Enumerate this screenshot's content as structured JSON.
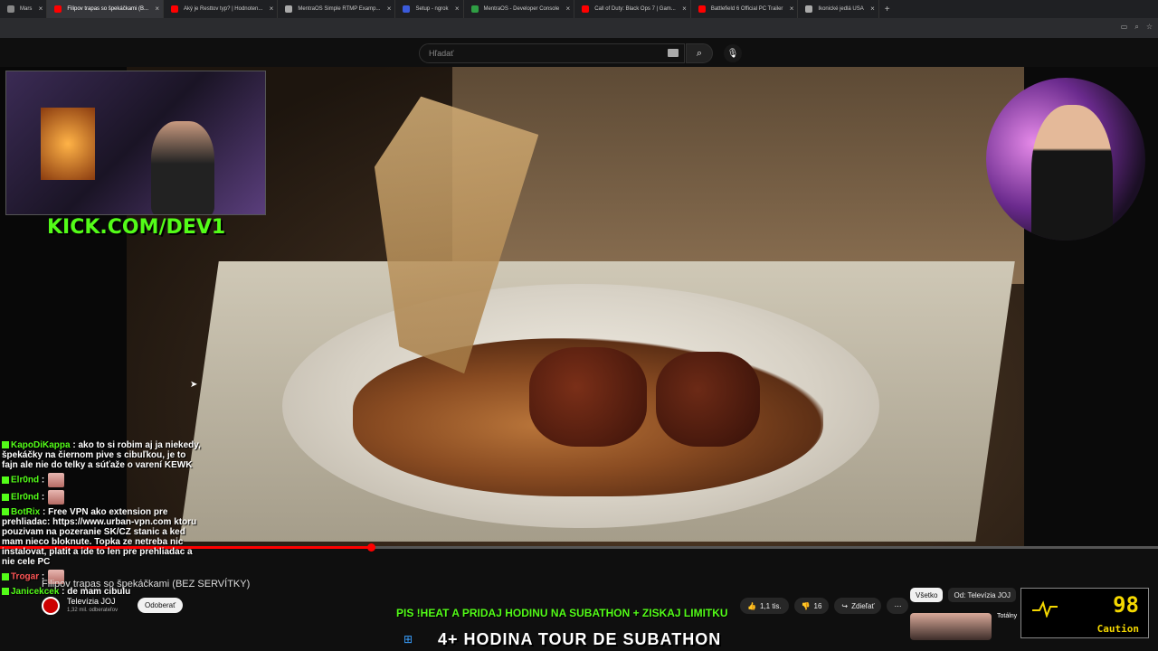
{
  "tabs": [
    {
      "label": "Mars",
      "color": "#888888",
      "active": false
    },
    {
      "label": "Filipov trapas so špekáčkami (B...",
      "color": "#ff0000",
      "active": true
    },
    {
      "label": "Aký je Resttov typ? | Hodnoten...",
      "color": "#ff0000",
      "active": false
    },
    {
      "label": "MentraOS Simple RTMP Examp...",
      "color": "#aaaaaa",
      "active": false
    },
    {
      "label": "Setup - ngrok",
      "color": "#3b5bdb",
      "active": false
    },
    {
      "label": "MentraOS - Developer Console",
      "color": "#2f9e44",
      "active": false
    },
    {
      "label": "Call of Duty: Black Ops 7 | Gam...",
      "color": "#ff0000",
      "active": false
    },
    {
      "label": "Battlefield 6 Official PC Trailer",
      "color": "#ff0000",
      "active": false
    },
    {
      "label": "Ikonické jedlá USA",
      "color": "#aaaaaa",
      "active": false
    }
  ],
  "newtab": "+",
  "search": {
    "placeholder": "Hľadať"
  },
  "overlay": {
    "kick": "KICK.COM/DEV1",
    "ticker": "PIS !HEAT A PRIDAJ HODINU NA SUBATHON + ZISKAJ LIMITKU",
    "banner": "4+ HODINA TOUR DE SUBATHON"
  },
  "chat": [
    {
      "user": "KapoDiKappa",
      "text": ": ako to si robim aj ja niekedy, špekáčky na čiernom pive s cibuľkou, je to fajn ale nie do telky a súťaže o varení KEWK"
    },
    {
      "user": "Elr0nd",
      "text": ":"
    },
    {
      "user": "Elr0nd",
      "text": ":"
    },
    {
      "user": "BotRix",
      "text": ": Free VPN ako extension pre prehliadac: https://www.urban-vpn.com ktoru pouzivam na pozeranie SK/CZ stanic a ked mam nieco bloknute. Topka ze netreba nic instalovat, platit a ide to len pre prehliadac a nie cele PC"
    },
    {
      "user": "Trogar",
      "text": ":",
      "red": true
    },
    {
      "user": "Janicekcek",
      "text": ": de mam cibulu"
    }
  ],
  "video": {
    "title": "Filipov trapas so špekáčkami (BEZ SERVÍTKY)",
    "channel": "Televízia JOJ",
    "subs": "1,32 mil. odberateľov",
    "subscribe": "Odoberať",
    "likes": "1,1 tis.",
    "dislikes": "16",
    "share": "Zdieľať",
    "more": "⋯",
    "progress": 0.32
  },
  "chips": [
    "Všetko",
    "Od: Televízia JOJ"
  ],
  "related": {
    "title": "Totálny"
  },
  "meter": {
    "value": "98",
    "label": "Caution"
  }
}
